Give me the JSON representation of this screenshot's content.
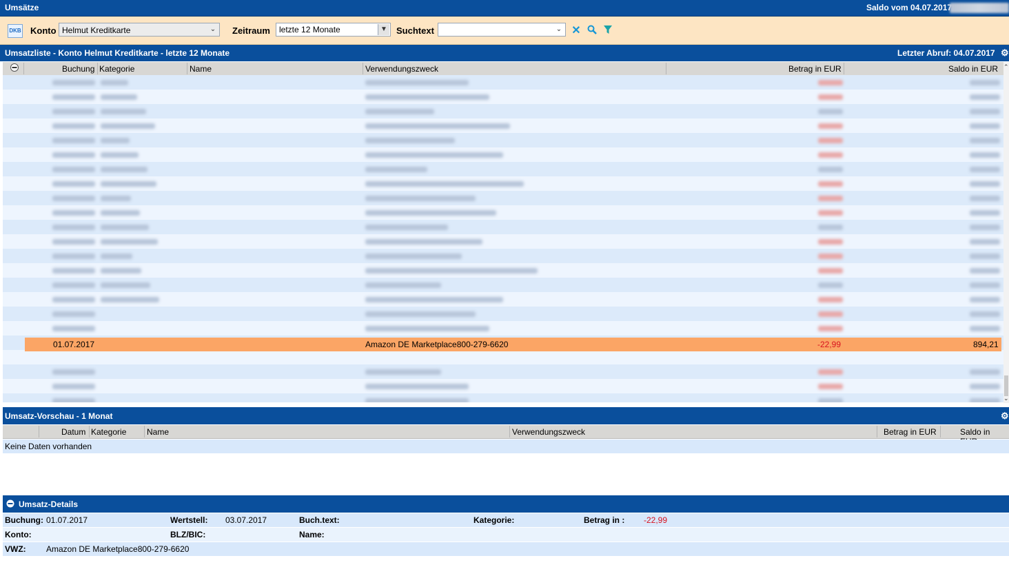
{
  "window": {
    "title": "Umsätze",
    "saldo_label": "Saldo vom 04.07.2017"
  },
  "toolbar": {
    "bank_logo": "DKB",
    "konto_label": "Konto",
    "konto_value": "Helmut Kreditkarte",
    "zeitraum_label": "Zeitraum",
    "zeitraum_value": "letzte 12 Monate",
    "suchtext_label": "Suchtext",
    "suchtext_value": "",
    "icons": [
      "clear-icon",
      "search-icon",
      "filter-icon"
    ]
  },
  "list": {
    "title": "Umsatzliste - Konto Helmut Kreditkarte - letzte 12 Monate",
    "last_fetch": "Letzter Abruf: 04.07.2017",
    "columns": [
      "Buchung",
      "Kategorie",
      "Name",
      "Verwendungszweck",
      "Betrag in EUR",
      "Saldo in EUR"
    ],
    "selected": {
      "buchung": "01.07.2017",
      "kategorie": "",
      "name": "",
      "verwendungszweck": "Amazon DE Marketplace800-279-6620",
      "betrag": "-22,99",
      "saldo": "894,21"
    }
  },
  "preview": {
    "title": "Umsatz-Vorschau - 1 Monat",
    "columns": [
      "Datum",
      "Kategorie",
      "Name",
      "Verwendungszweck",
      "Betrag in EUR",
      "Saldo in EUR"
    ],
    "empty_text": "Keine Daten vorhanden"
  },
  "details": {
    "title": "Umsatz-Details",
    "buchung_label": "Buchung:",
    "buchung_value": "01.07.2017",
    "wertstell_label": "Wertstell:",
    "wertstell_value": "03.07.2017",
    "buchtext_label": "Buch.text:",
    "kategorie_label": "Kategorie:",
    "betrag_label": "Betrag in :",
    "betrag_value": "-22,99",
    "konto_label": "Konto:",
    "blz_label": "BLZ/BIC:",
    "name_label": "Name:",
    "vwz_label": "VWZ:",
    "vwz_value": "Amazon DE Marketplace800-279-6620"
  },
  "colors": {
    "header_blue": "#0a4f9c",
    "toolbar_bg": "#fde5c3",
    "selected_row": "#fba565",
    "negative": "#d8121f"
  }
}
